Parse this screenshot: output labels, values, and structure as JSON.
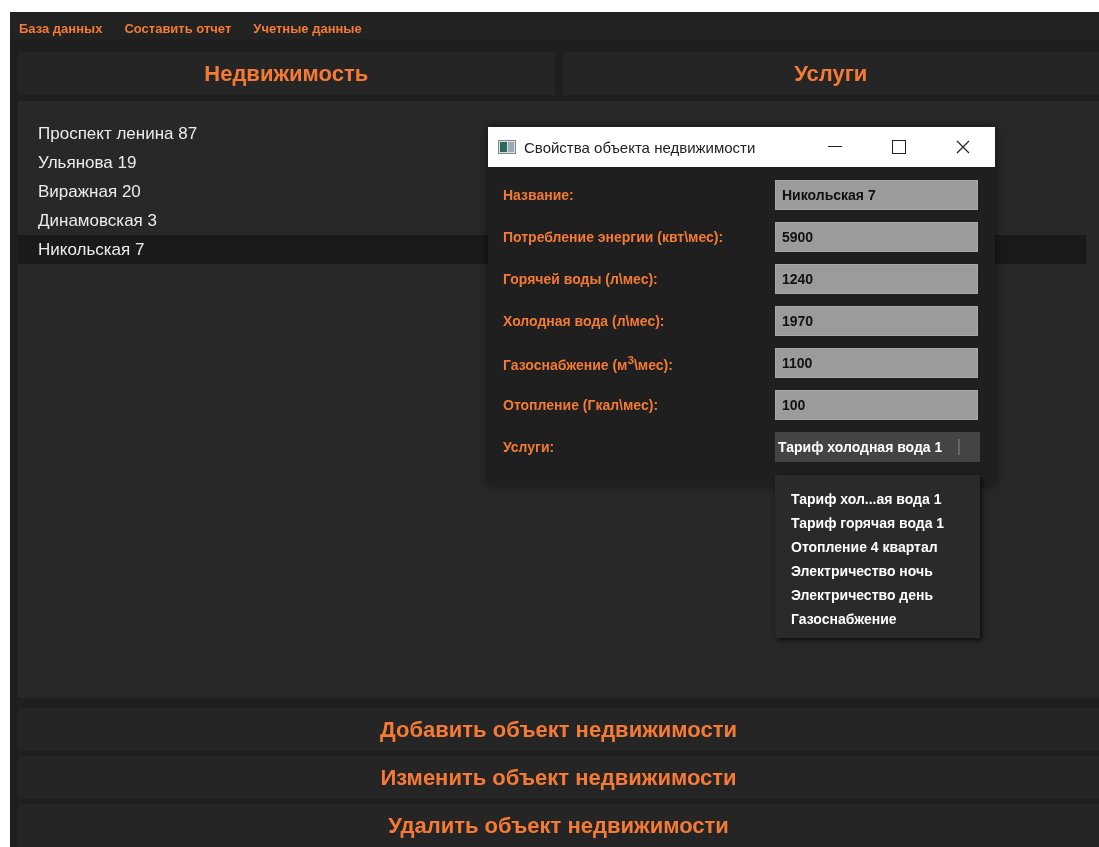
{
  "menu": [
    "База данных",
    "Составить отчет",
    "Учетные данные"
  ],
  "tabs": [
    "Недвижимость",
    "Услуги"
  ],
  "properties": [
    {
      "name": "Проспект ленина 87",
      "selected": false
    },
    {
      "name": "Ульянова 19",
      "selected": false
    },
    {
      "name": "Виражная 20",
      "selected": false
    },
    {
      "name": "Динамовская 3",
      "selected": false
    },
    {
      "name": "Никольская 7",
      "selected": true
    }
  ],
  "actions": [
    "Добавить объект недвижимости",
    "Изменить объект недвижимости",
    "Удалить объект недвижимости"
  ],
  "dialog": {
    "title": "Свойства объекта недвижимости",
    "fields": [
      {
        "label": "Название:",
        "value": "Никольская 7"
      },
      {
        "label": "Потребление энергии (квт\\мес):",
        "value": "5900"
      },
      {
        "label": "Горячей воды (л\\мес):",
        "value": "1240"
      },
      {
        "label": "Холодная вода (л\\мес):",
        "value": "1970"
      },
      {
        "label": "Газоснабжение (м$^{3}$\\мес):",
        "value": "1100"
      },
      {
        "label": "Отопление (Гкал\\мес):",
        "value": "100"
      }
    ],
    "services": {
      "label": "Услуги:",
      "value": "Тариф холодная вода 1",
      "options": [
        "Тариф хол...ая вода 1",
        "Тариф горячая вода 1",
        "Отопление 4 квартал",
        "Электричество ночь",
        "Электричество день",
        "Газоснабжение"
      ]
    }
  }
}
